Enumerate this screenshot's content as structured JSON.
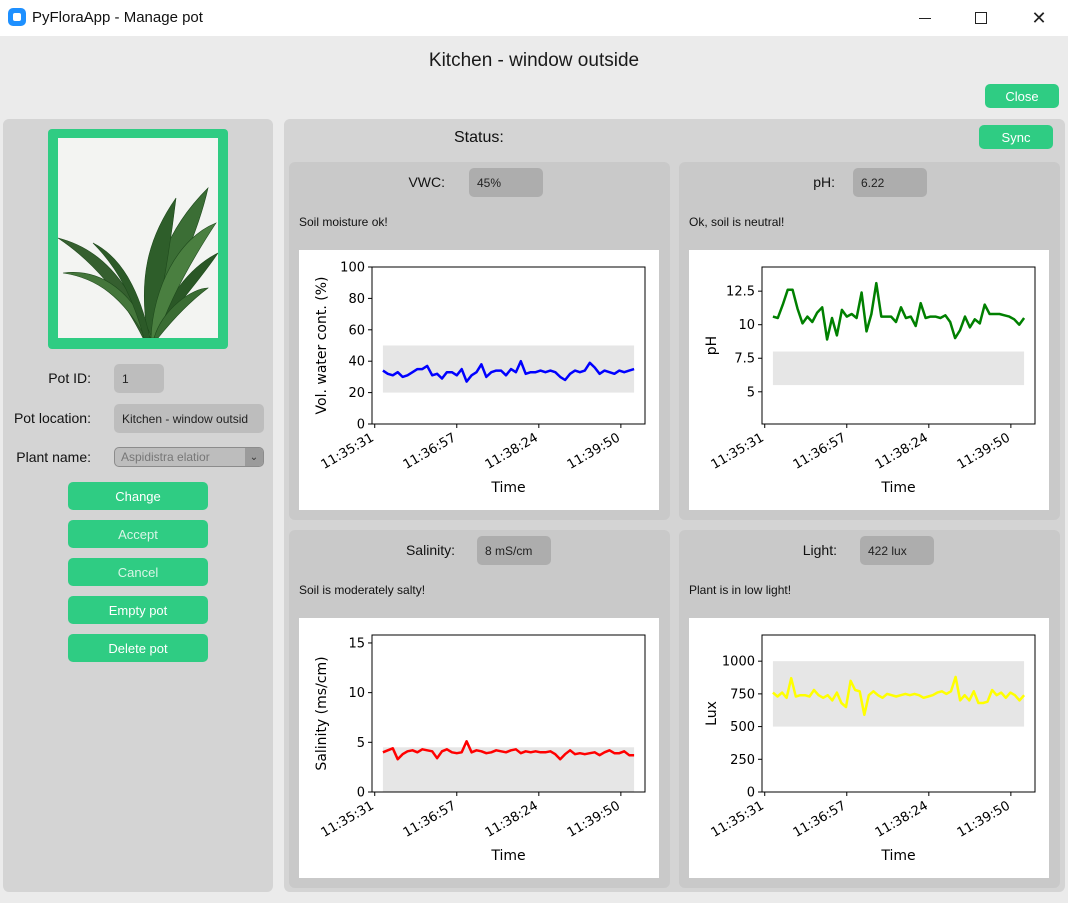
{
  "window": {
    "title": "PyFloraApp - Manage pot",
    "close_glyph": "✕",
    "min_icon": "minimize-icon",
    "max_icon": "maximize-icon",
    "close_icon": "close-icon"
  },
  "header": {
    "title": "Kitchen - window outside",
    "close_button": "Close"
  },
  "pot": {
    "id_label": "Pot ID:",
    "id_value": "1",
    "location_label": "Pot location:",
    "location_value": "Kitchen - window outsid",
    "plant_label": "Plant name:",
    "plant_value": "Aspidistra elatior",
    "select_arrow": "⌄"
  },
  "actions": {
    "change": "Change",
    "accept": "Accept",
    "cancel": "Cancel",
    "empty": "Empty pot",
    "delete": "Delete pot"
  },
  "status": {
    "title": "Status:",
    "sync_button": "Sync"
  },
  "colors": {
    "accent": "#2fcc83",
    "panel": "#d4d4d4",
    "card": "#c9c9c9"
  },
  "cards": [
    {
      "label": "VWC:",
      "value": "45%",
      "message": "Soil moisture ok!"
    },
    {
      "label": "pH:",
      "value": "6.22",
      "message": "Ok, soil is neutral!"
    },
    {
      "label": "Salinity:",
      "value": "8 mS/cm",
      "message": "Soil is moderately salty!"
    },
    {
      "label": "Light:",
      "value": "422 lux",
      "message": "Plant is in low light!"
    }
  ],
  "chart_data": [
    {
      "type": "line",
      "xlabel": "Time",
      "ylabel": "Vol. water cont. (%)",
      "xticks": [
        "11:35:31",
        "11:36:57",
        "11:38:24",
        "11:39:50"
      ],
      "ylim": [
        0,
        100
      ],
      "yticks": [
        0,
        20,
        40,
        60,
        80,
        100
      ],
      "band": [
        20,
        50
      ],
      "color": "#0000ff",
      "values": [
        34,
        32,
        31,
        33,
        30,
        31,
        33,
        35,
        35,
        37,
        31,
        32,
        29,
        33,
        33,
        31,
        35,
        27,
        31,
        33,
        38,
        30,
        33,
        34,
        34,
        31,
        35,
        33,
        40,
        32,
        33,
        33,
        34,
        33,
        34,
        33,
        30,
        28,
        32,
        34,
        33,
        34,
        39,
        36,
        32,
        34,
        33,
        32,
        34,
        33,
        34,
        35
      ]
    },
    {
      "type": "line",
      "xlabel": "Time",
      "ylabel": "pH",
      "xticks": [
        "11:35:31",
        "11:36:57",
        "11:38:24",
        "11:39:50"
      ],
      "ylim": [
        2.6,
        14.3
      ],
      "yticks": [
        5.0,
        7.5,
        10.0,
        12.5
      ],
      "band": [
        5.5,
        8.0
      ],
      "color": "#008000",
      "values": [
        10.6,
        10.5,
        11.5,
        12.6,
        12.6,
        11.2,
        10.1,
        10.6,
        10.2,
        10.9,
        11.3,
        8.9,
        10.5,
        9.2,
        11.1,
        10.6,
        10.8,
        10.5,
        12.4,
        9.5,
        10.8,
        13.1,
        10.6,
        10.6,
        10.6,
        10.2,
        11.3,
        10.5,
        10.6,
        9.9,
        11.6,
        10.5,
        10.6,
        10.6,
        10.5,
        10.7,
        10.2,
        9.0,
        9.6,
        10.6,
        9.8,
        10.4,
        10.1,
        11.5,
        10.8,
        10.8,
        10.8,
        10.7,
        10.6,
        10.4,
        10.0,
        10.5
      ]
    },
    {
      "type": "line",
      "xlabel": "Time",
      "ylabel": "Salinity (ms/cm)",
      "xticks": [
        "11:35:31",
        "11:36:57",
        "11:38:24",
        "11:39:50"
      ],
      "ylim": [
        0,
        15.8
      ],
      "yticks": [
        0,
        5,
        10,
        15
      ],
      "band": [
        0,
        4.5
      ],
      "color": "#ff0000",
      "values": [
        4.0,
        4.2,
        4.4,
        3.3,
        3.8,
        4.1,
        4.2,
        4.0,
        4.3,
        4.2,
        4.1,
        3.4,
        4.1,
        4.3,
        4.0,
        3.9,
        4.0,
        5.1,
        4.0,
        4.2,
        4.1,
        3.9,
        4.0,
        4.2,
        4.1,
        4.0,
        4.2,
        4.3,
        3.9,
        4.1,
        4.0,
        4.1,
        4.0,
        4.0,
        4.1,
        3.8,
        3.3,
        3.8,
        4.2,
        3.8,
        3.9,
        3.8,
        3.9,
        4.0,
        3.7,
        4.0,
        4.2,
        3.9,
        3.9,
        4.1,
        3.7,
        3.7
      ]
    },
    {
      "type": "line",
      "xlabel": "Time",
      "ylabel": "Lux",
      "xticks": [
        "11:35:31",
        "11:36:57",
        "11:38:24",
        "11:39:50"
      ],
      "ylim": [
        0,
        1200
      ],
      "yticks": [
        0,
        250,
        500,
        750,
        1000
      ],
      "band": [
        500,
        1000
      ],
      "color": "#ffff00",
      "values": [
        760,
        730,
        760,
        720,
        870,
        730,
        740,
        740,
        730,
        780,
        740,
        720,
        740,
        700,
        760,
        680,
        650,
        850,
        780,
        770,
        590,
        740,
        770,
        740,
        720,
        750,
        740,
        730,
        740,
        750,
        740,
        750,
        740,
        720,
        730,
        740,
        760,
        770,
        750,
        770,
        880,
        700,
        740,
        700,
        770,
        680,
        680,
        690,
        780,
        740,
        760,
        720,
        760,
        740,
        700,
        740
      ]
    }
  ]
}
